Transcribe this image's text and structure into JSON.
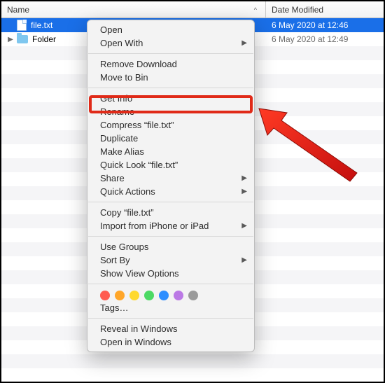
{
  "header": {
    "name_col": "Name",
    "date_col": "Date Modified"
  },
  "rows": [
    {
      "name": "file.txt",
      "date": "6 May 2020 at 12:46",
      "type": "file"
    },
    {
      "name": "Folder",
      "date": "6 May 2020 at 12:49",
      "type": "folder"
    }
  ],
  "menu": {
    "open": "Open",
    "open_with": "Open With",
    "remove_download": "Remove Download",
    "move_to_bin": "Move to Bin",
    "get_info": "Get Info",
    "rename": "Rename",
    "compress": "Compress “file.txt”",
    "duplicate": "Duplicate",
    "make_alias": "Make Alias",
    "quick_look": "Quick Look “file.txt”",
    "share": "Share",
    "quick_actions": "Quick Actions",
    "copy": "Copy “file.txt”",
    "import": "Import from iPhone or iPad",
    "use_groups": "Use Groups",
    "sort_by": "Sort By",
    "show_view_options": "Show View Options",
    "tags": "Tags…",
    "reveal": "Reveal in Windows",
    "open_in": "Open in Windows"
  },
  "tag_colors": [
    "#ff5b50",
    "#ffa629",
    "#ffd92e",
    "#4cd964",
    "#2d8eff",
    "#bb79e5",
    "#9a9a9a"
  ]
}
